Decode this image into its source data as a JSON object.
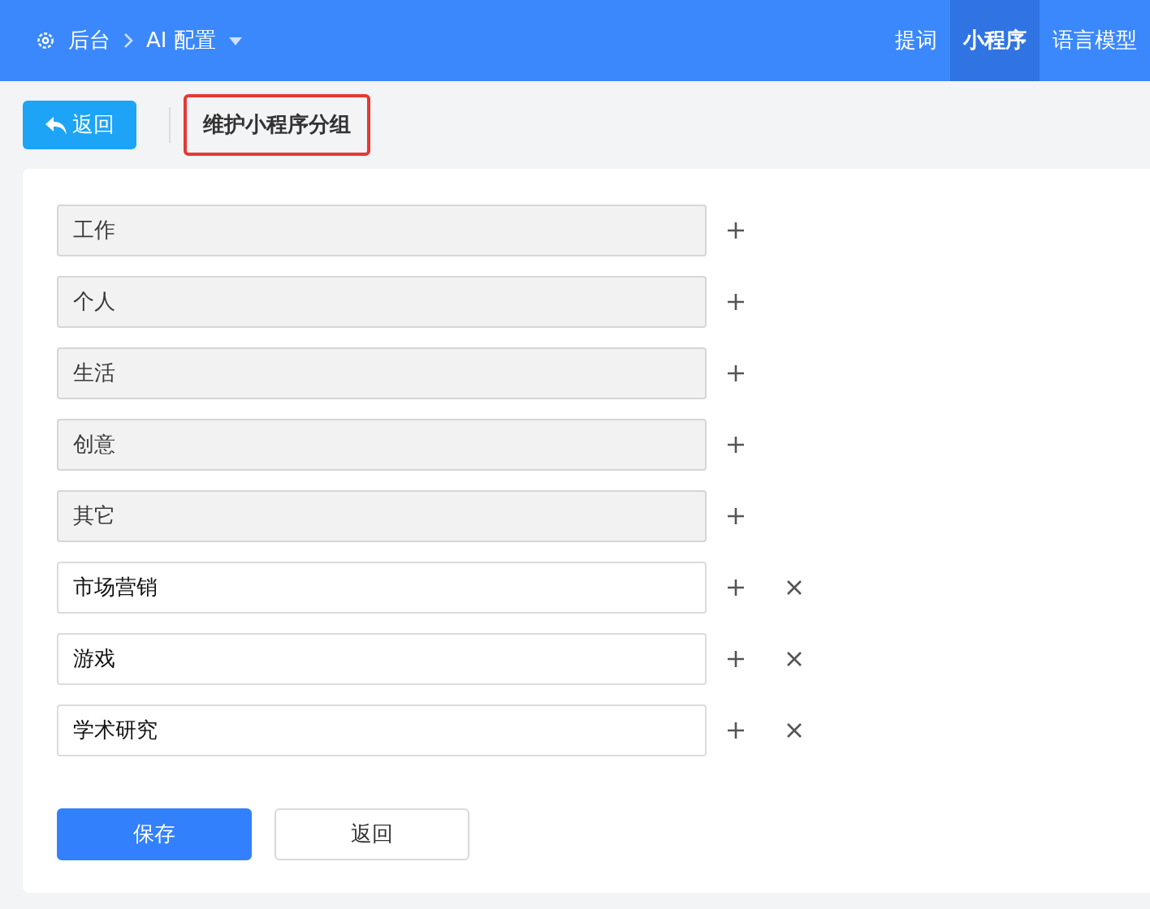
{
  "header": {
    "breadcrumb": [
      {
        "label": "后台",
        "kind": "home"
      },
      {
        "label": "AI 配置",
        "kind": "dropdown"
      }
    ],
    "tabs": [
      {
        "label": "提词",
        "selected": false
      },
      {
        "label": "小程序",
        "selected": true
      },
      {
        "label": "语言模型",
        "selected": false
      }
    ]
  },
  "toolbar": {
    "back_button": "返回",
    "title": "维护小程序分组",
    "title_highlighted": true
  },
  "groups": [
    {
      "value": "工作",
      "disabled": true,
      "removable": false
    },
    {
      "value": "个人",
      "disabled": true,
      "removable": false
    },
    {
      "value": "生活",
      "disabled": true,
      "removable": false
    },
    {
      "value": "创意",
      "disabled": true,
      "removable": false
    },
    {
      "value": "其它",
      "disabled": true,
      "removable": false
    },
    {
      "value": "市场营销",
      "disabled": false,
      "removable": true
    },
    {
      "value": "游戏",
      "disabled": false,
      "removable": true
    },
    {
      "value": "学术研究",
      "disabled": false,
      "removable": true
    }
  ],
  "buttons": [
    {
      "label": "保存",
      "kind": "primary"
    },
    {
      "label": "返回",
      "kind": "default"
    }
  ]
}
